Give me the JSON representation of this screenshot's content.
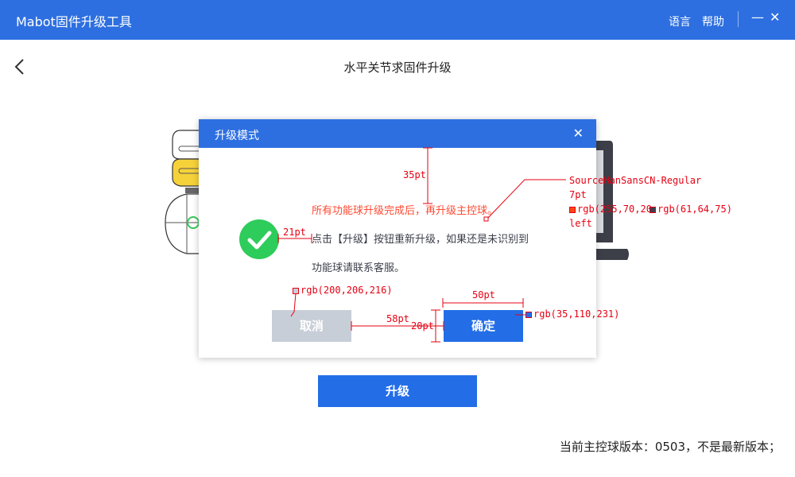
{
  "app": {
    "title": "Mabot固件升级工具",
    "menu_language": "语言",
    "menu_help": "帮助",
    "minimize_glyph": "—",
    "close_glyph": "✕"
  },
  "page": {
    "title": "水平关节求固件升级"
  },
  "modal": {
    "title": "升级模式",
    "close_glyph": "✕",
    "warning": "所有功能球升级完成后，再升级主控球。",
    "message_line1": "点击【升级】按钮重新升级，如果还是未识别到",
    "message_line2": "功能球请联系客服。",
    "cancel_label": "取消",
    "confirm_label": "确定"
  },
  "upgrade_button": "升级",
  "version_status": "当前主控球版本：0503，不是最新版本；",
  "annotations": {
    "spacing_top": "35pt",
    "spacing_icon": "21pt",
    "font_name": "SourceHanSansCN-Regular",
    "font_size": "7pt",
    "color_warning": "rgb(255,70,20",
    "color_text": "rgb(61,64,75)",
    "align": "left",
    "color_cancel": "rgb(200,206,216)",
    "btn_width": "50pt",
    "btn_gap": "58pt",
    "btn_height": "20pt",
    "color_confirm": "rgb(35,110,231)"
  },
  "colors": {
    "primary": "#236ee7",
    "titlebar": "#2d6fe0",
    "warning": "#ff4a33",
    "cancel": "#c8ced8",
    "text": "#3d404b",
    "success": "#2ecc5a",
    "annotation": "#e60012"
  }
}
